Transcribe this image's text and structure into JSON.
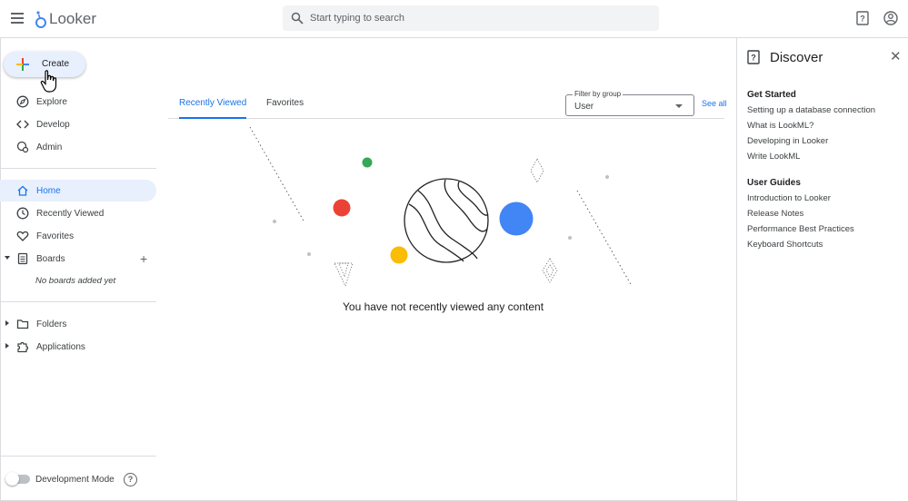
{
  "app": {
    "name": "Looker"
  },
  "search": {
    "placeholder": "Start typing to search"
  },
  "sidebar": {
    "create_label": "Create",
    "top_items": [
      {
        "label": "Explore",
        "icon": "compass-icon"
      },
      {
        "label": "Develop",
        "icon": "code-icon"
      },
      {
        "label": "Admin",
        "icon": "admin-gear-icon"
      }
    ],
    "main_items": [
      {
        "label": "Home",
        "icon": "home-icon",
        "active": true
      },
      {
        "label": "Recently Viewed",
        "icon": "clock-icon"
      },
      {
        "label": "Favorites",
        "icon": "heart-icon"
      },
      {
        "label": "Boards",
        "icon": "board-icon",
        "expanded": true
      }
    ],
    "boards_empty": "No boards added yet",
    "bottom_items": [
      {
        "label": "Folders",
        "icon": "folder-icon"
      },
      {
        "label": "Applications",
        "icon": "puzzle-icon"
      }
    ],
    "dev_mode_label": "Development Mode",
    "dev_mode_on": false
  },
  "main": {
    "tabs": [
      {
        "label": "Recently Viewed",
        "active": true
      },
      {
        "label": "Favorites",
        "active": false
      }
    ],
    "filter": {
      "label": "Filter by group",
      "value": "User"
    },
    "see_all": "See all",
    "empty_message": "You have not recently viewed any content"
  },
  "discover": {
    "title": "Discover",
    "sections": [
      {
        "heading": "Get Started",
        "links": [
          "Setting up a database connection",
          "What is LookML?",
          "Developing in Looker",
          "Write LookML"
        ]
      },
      {
        "heading": "User Guides",
        "links": [
          "Introduction to Looker",
          "Release Notes",
          "Performance Best Practices",
          "Keyboard Shortcuts"
        ]
      }
    ]
  },
  "colors": {
    "accent": "#1a73e8",
    "active_bg": "#e8f0fe",
    "google_green": "#34a853",
    "google_red": "#ea4335",
    "google_yellow": "#fbbc04",
    "google_blue": "#4285f4"
  }
}
